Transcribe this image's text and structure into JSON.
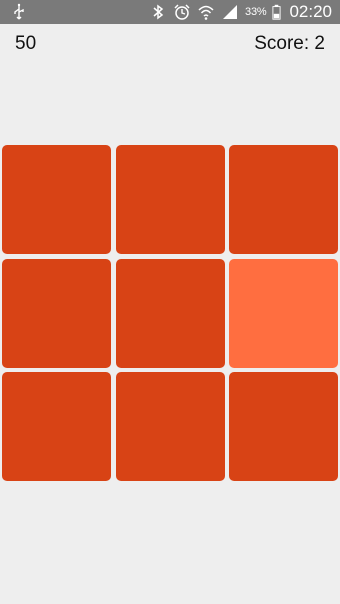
{
  "status_bar": {
    "icons": [
      "usb-icon",
      "bluetooth-icon",
      "alarm-icon",
      "wifi-icon",
      "signal-icon",
      "battery-icon"
    ],
    "battery_text": "33%",
    "time": "02:20"
  },
  "hud": {
    "timer": "50",
    "score": "Score: 2"
  },
  "board": {
    "rows": 3,
    "cols": 3,
    "base_color": "#d84315",
    "odd_color": "#ff6e40",
    "odd_tile": {
      "row": 2,
      "col": 3
    }
  }
}
